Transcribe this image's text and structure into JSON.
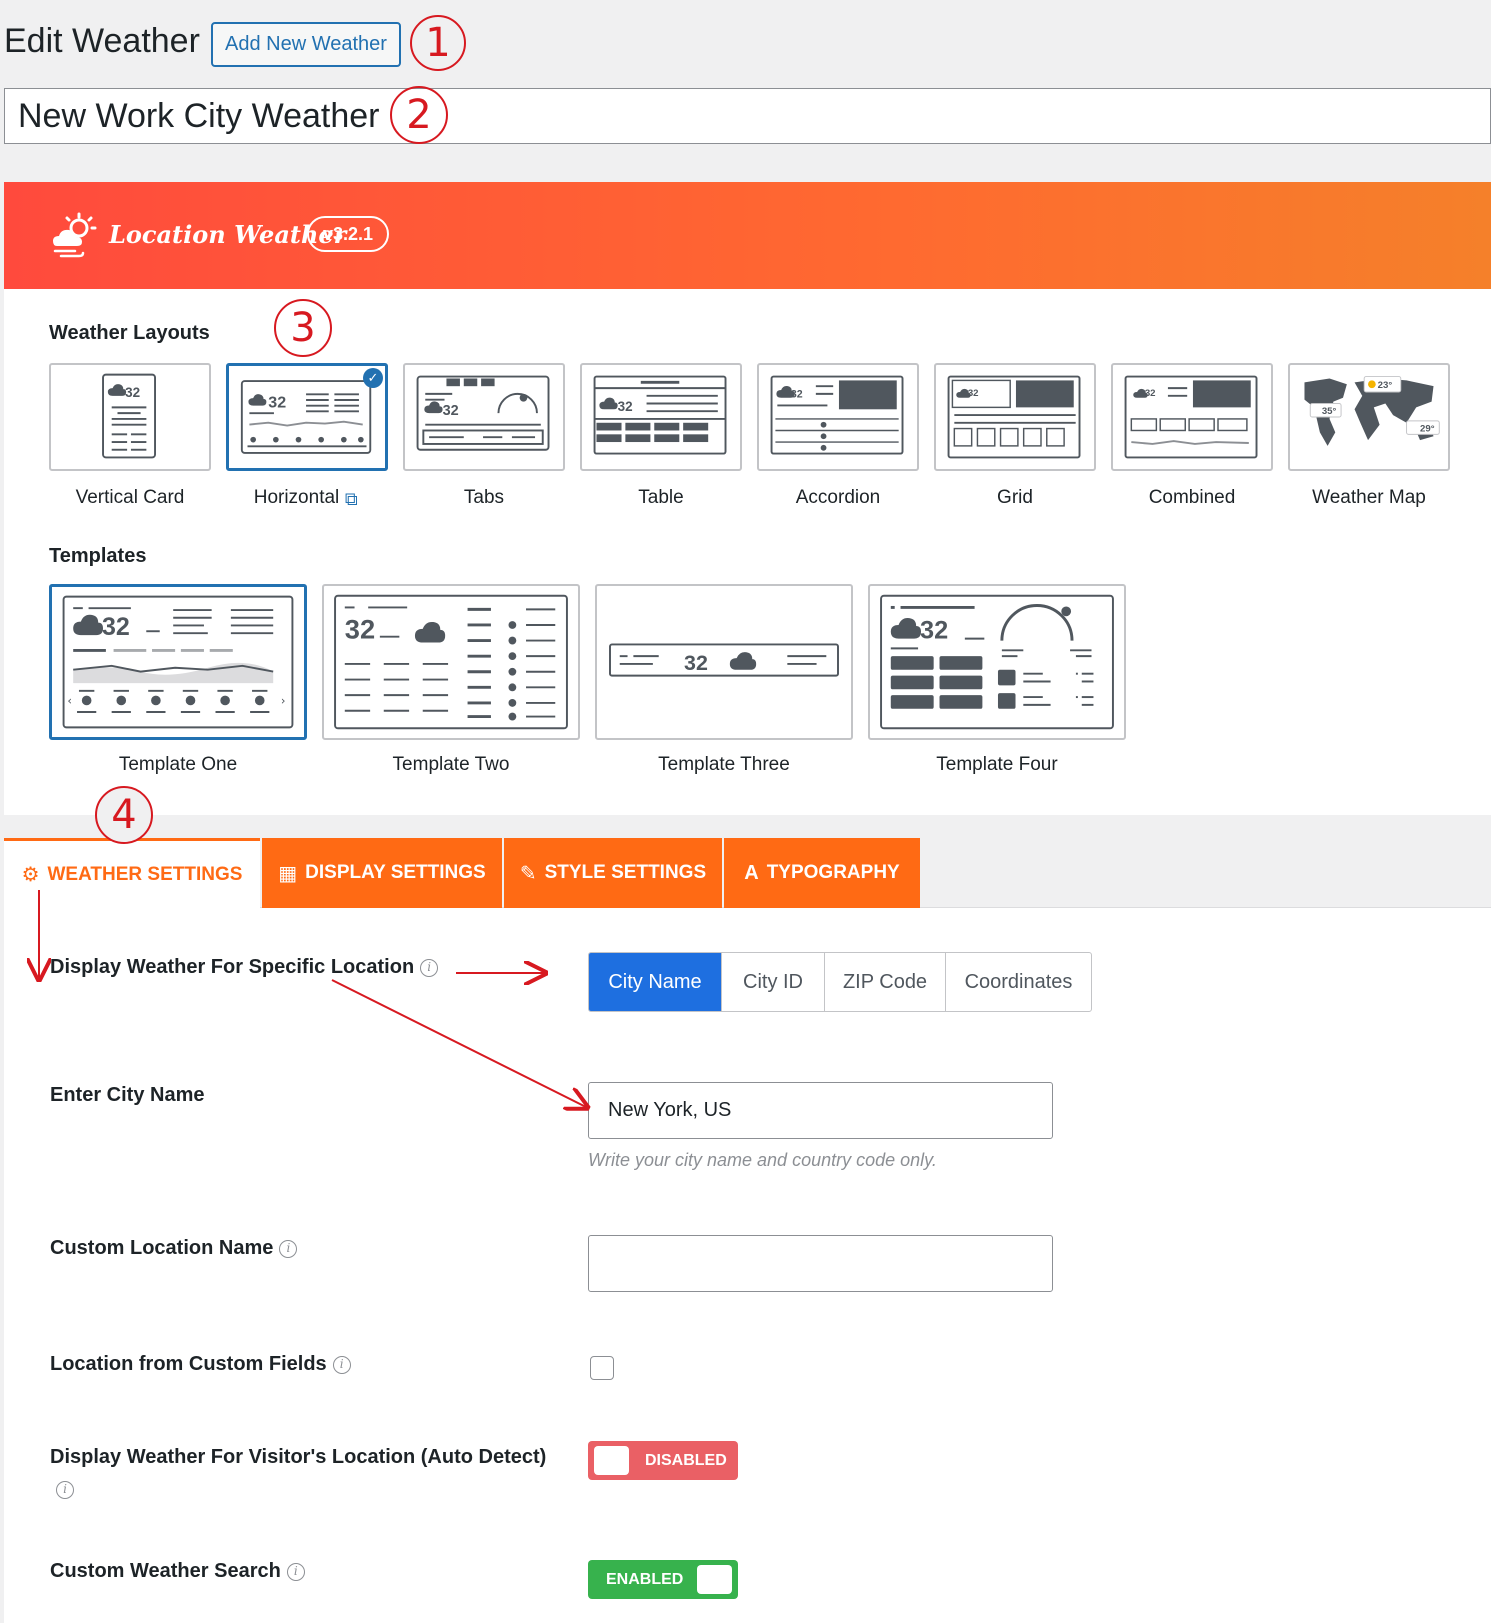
{
  "header": {
    "title": "Edit Weather",
    "add_new_label": "Add New Weather"
  },
  "post_title": "New Work City Weather",
  "brand": {
    "name": "Location Weather",
    "version": "v3.2.1"
  },
  "callouts": [
    "1",
    "2",
    "3",
    "4"
  ],
  "layouts": {
    "label": "Weather Layouts",
    "items": [
      {
        "label": "Vertical Card"
      },
      {
        "label": "Horizontal"
      },
      {
        "label": "Tabs"
      },
      {
        "label": "Table"
      },
      {
        "label": "Accordion"
      },
      {
        "label": "Grid"
      },
      {
        "label": "Combined"
      },
      {
        "label": "Weather Map"
      }
    ],
    "selected": "Horizontal",
    "preview_temp": "32",
    "map_temps": [
      "23°",
      "35°",
      "29°"
    ]
  },
  "templates": {
    "label": "Templates",
    "items": [
      {
        "label": "Template One"
      },
      {
        "label": "Template Two"
      },
      {
        "label": "Template Three"
      },
      {
        "label": "Template Four"
      }
    ],
    "selected": "Template One"
  },
  "tabs": [
    {
      "label": "WEATHER SETTINGS",
      "icon": "gear-icon"
    },
    {
      "label": "DISPLAY SETTINGS",
      "icon": "grid-icon"
    },
    {
      "label": "STYLE SETTINGS",
      "icon": "palette-icon"
    },
    {
      "label": "TYPOGRAPHY",
      "icon": "typography-icon"
    }
  ],
  "settings": {
    "location_type": {
      "label": "Display Weather For Specific Location",
      "options": [
        "City Name",
        "City ID",
        "ZIP Code",
        "Coordinates"
      ],
      "selected": "City Name"
    },
    "city_name": {
      "label": "Enter City Name",
      "value": "New York, US",
      "help": "Write your city name and country code only."
    },
    "custom_location": {
      "label": "Custom Location Name",
      "value": ""
    },
    "custom_fields": {
      "label": "Location from Custom Fields",
      "checked": false
    },
    "auto_detect": {
      "label": "Display Weather For Visitor's Location (Auto Detect)",
      "state": "DISABLED"
    },
    "custom_search": {
      "label": "Custom Weather Search",
      "state": "ENABLED"
    }
  },
  "colors": {
    "brand_orange": "#ff6a14",
    "selected_blue": "#2271b1",
    "segment_blue": "#1e6fe0",
    "disabled_red": "#ea6065",
    "enabled_green": "#37b24d",
    "annotation_red": "#d71920"
  }
}
